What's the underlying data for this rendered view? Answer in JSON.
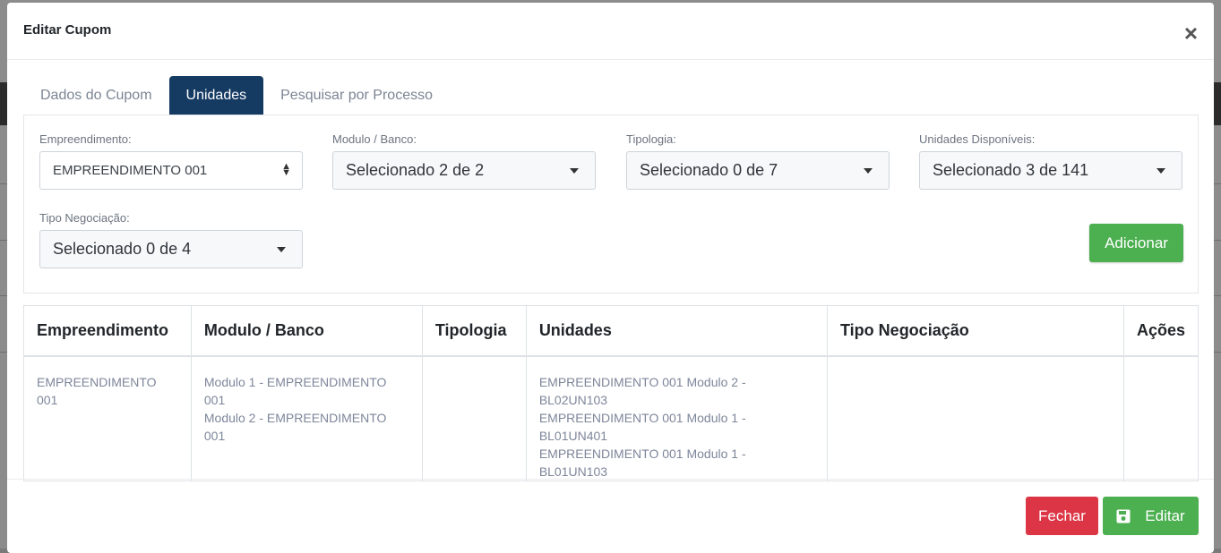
{
  "modal": {
    "title": "Editar Cupom",
    "close_glyph": "×"
  },
  "tabs": [
    {
      "label": "Dados do Cupom"
    },
    {
      "label": "Unidades"
    },
    {
      "label": "Pesquisar por Processo"
    }
  ],
  "form": {
    "empreendimento": {
      "label": "Empreendimento:",
      "value": "EMPREENDIMENTO 001"
    },
    "modulo": {
      "label": "Modulo / Banco:",
      "value": "Selecionado 2 de 2"
    },
    "tipologia": {
      "label": "Tipologia:",
      "value": "Selecionado 0 de 7"
    },
    "unidades": {
      "label": "Unidades Disponíveis:",
      "value": "Selecionado 3 de 141"
    },
    "tipo_negociacao": {
      "label": "Tipo Negociação:",
      "value": "Selecionado 0 de 4"
    },
    "add_label": "Adicionar"
  },
  "table": {
    "headers": [
      "Empreendimento",
      "Modulo / Banco",
      "Tipologia",
      "Unidades",
      "Tipo Negociação",
      "Ações"
    ],
    "row": {
      "empreendimento": "EMPREENDIMENTO 001",
      "modulos": [
        "Modulo 1 - EMPREENDIMENTO 001",
        "Modulo 2 - EMPREENDIMENTO 001"
      ],
      "tipologia": "",
      "unidades": [
        "EMPREENDIMENTO 001 Modulo 2 - BL02UN103",
        "EMPREENDIMENTO 001 Modulo 1 - BL01UN401",
        "EMPREENDIMENTO 001 Modulo 1 - BL01UN103"
      ],
      "tipo_negociacao": "",
      "acoes": ""
    }
  },
  "footer": {
    "close_label": "Fechar",
    "edit_label": "Editar",
    "edit_icon": "save-icon"
  },
  "colors": {
    "primary_tab": "#163b63",
    "success": "#4caf50",
    "danger": "#dc3545"
  }
}
